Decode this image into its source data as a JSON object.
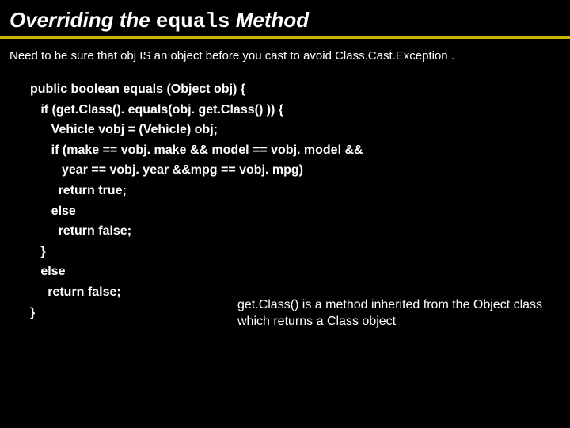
{
  "title": {
    "part1": "Overriding the ",
    "mono": "equals",
    "part2": " Method"
  },
  "subnote": "Need to be sure that obj IS an object before you cast to avoid Class.Cast.Exception .",
  "code": {
    "l0": "public boolean equals (Object obj) {",
    "l1": "   if (get.Class(). equals(obj. get.Class() )) {",
    "l2": "      Vehicle vobj = (Vehicle) obj;",
    "l3": "      if (make == vobj. make && model == vobj. model &&",
    "l4": "         year == vobj. year &&mpg == vobj. mpg)",
    "l5": "        return true;",
    "l6": "      else",
    "l7": "        return false;",
    "l8": "   }",
    "l9": "   else",
    "l10": "     return false;",
    "l11": "",
    "l12": "}"
  },
  "sidenote": "get.Class() is a method inherited from the Object class which returns a Class object"
}
